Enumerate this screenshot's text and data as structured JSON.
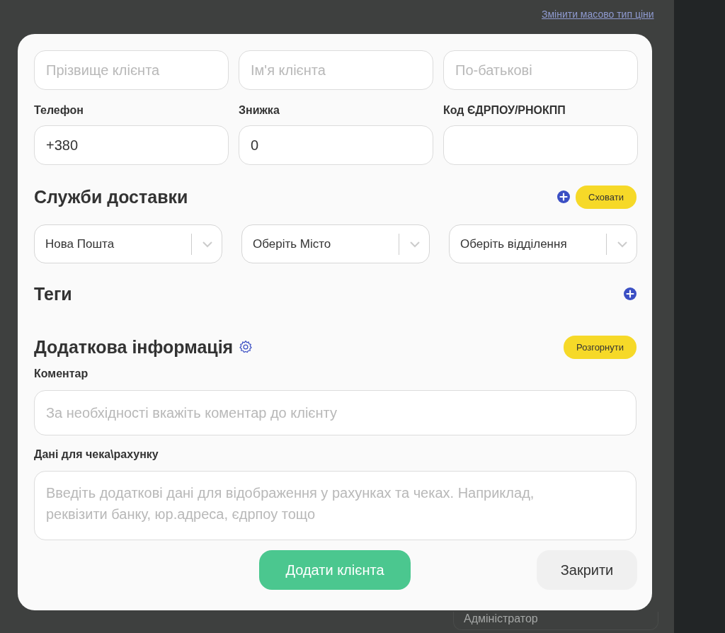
{
  "background": {
    "link": "Змінити масово тип ціни",
    "role_field": {
      "value": "Адміністратор"
    }
  },
  "dialog": {
    "name_fields": [
      {
        "placeholder": "Прізвище клієнта"
      },
      {
        "placeholder": "Ім'я клієнта"
      },
      {
        "placeholder": "По-батькові"
      }
    ],
    "contact_fields": [
      {
        "label": "Телефон",
        "value": "+380"
      },
      {
        "label": "Знижка",
        "value": "0"
      },
      {
        "label": "Код ЄДРПОУ/РНОКПП"
      }
    ],
    "delivery": {
      "title": "Служби доставки",
      "hide_button": "Сховати",
      "selects": [
        {
          "value": "Нова Пошта"
        },
        {
          "value": "Оберіть Місто"
        },
        {
          "value": "Оберіть відділення"
        }
      ]
    },
    "tags": {
      "title": "Теги"
    },
    "extra": {
      "title": "Додаткова інформація",
      "expand_button": "Розгорнути",
      "comment": {
        "label": "Коментар",
        "placeholder": "За необхідності вкажіть коментар до клієнту"
      },
      "receipt": {
        "label": "Дані для чека\\рахунку",
        "placeholder": "Введіть додаткові дані для відображення у рахунках та чеках. Наприклад, реквізити банку, юр.адреса, єдрпоу тощо"
      }
    },
    "buttons": {
      "primary": "Додати клієнта",
      "secondary": "Закрити"
    }
  }
}
